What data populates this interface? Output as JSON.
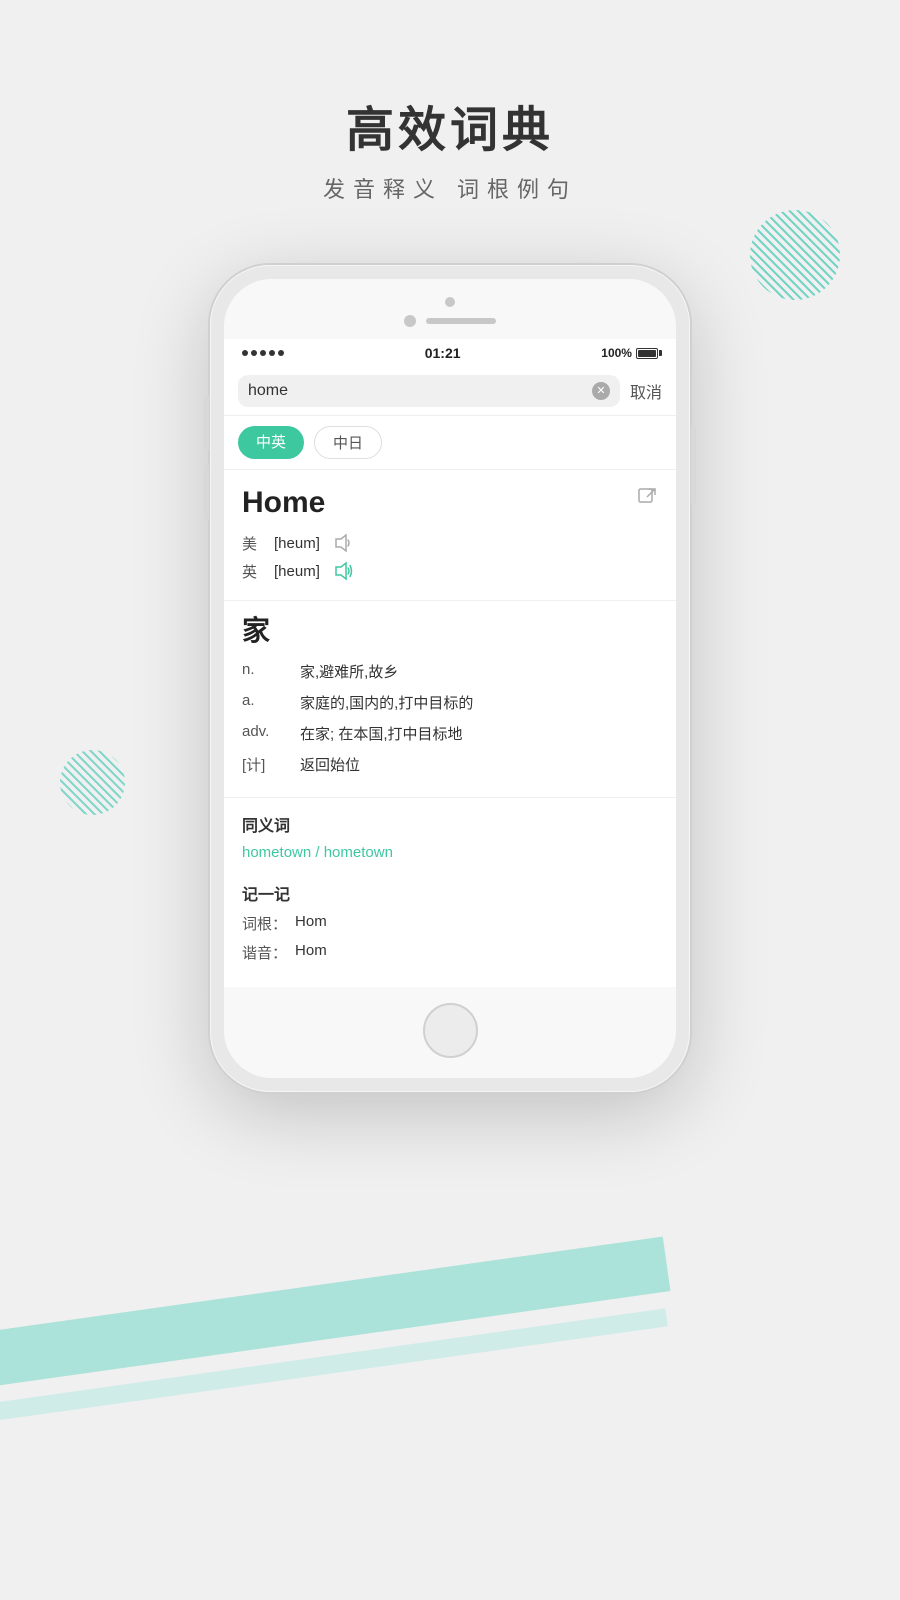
{
  "page": {
    "title": "高效词典",
    "subtitle": "发音释义  词根例句"
  },
  "status_bar": {
    "dots": 5,
    "time": "01:21",
    "battery_pct": "100%"
  },
  "search": {
    "query": "home",
    "cancel_label": "取消"
  },
  "tabs": [
    {
      "label": "中英",
      "active": true
    },
    {
      "label": "中日",
      "active": false
    }
  ],
  "word": {
    "title": "Home",
    "phonetics": [
      {
        "lang": "美",
        "text": "[heum]",
        "active": false
      },
      {
        "lang": "英",
        "text": "[heum]",
        "active": true
      }
    ],
    "chinese_head": "家",
    "definitions": [
      {
        "pos": "n.",
        "text": "家,避难所,故乡"
      },
      {
        "pos": "a.",
        "text": "家庭的,国内的,打中目标的"
      },
      {
        "pos": "adv.",
        "text": "在家; 在本国,打中目标地"
      },
      {
        "pos": "[计]",
        "text": "返回始位"
      }
    ],
    "synonyms": {
      "title": "同义词",
      "links": "hometown / hometown"
    },
    "memory": {
      "title": "记一记",
      "root_label": "词根：",
      "root_value": "Hom",
      "sound_label": "谐音：",
      "sound_value": "Hom"
    }
  }
}
